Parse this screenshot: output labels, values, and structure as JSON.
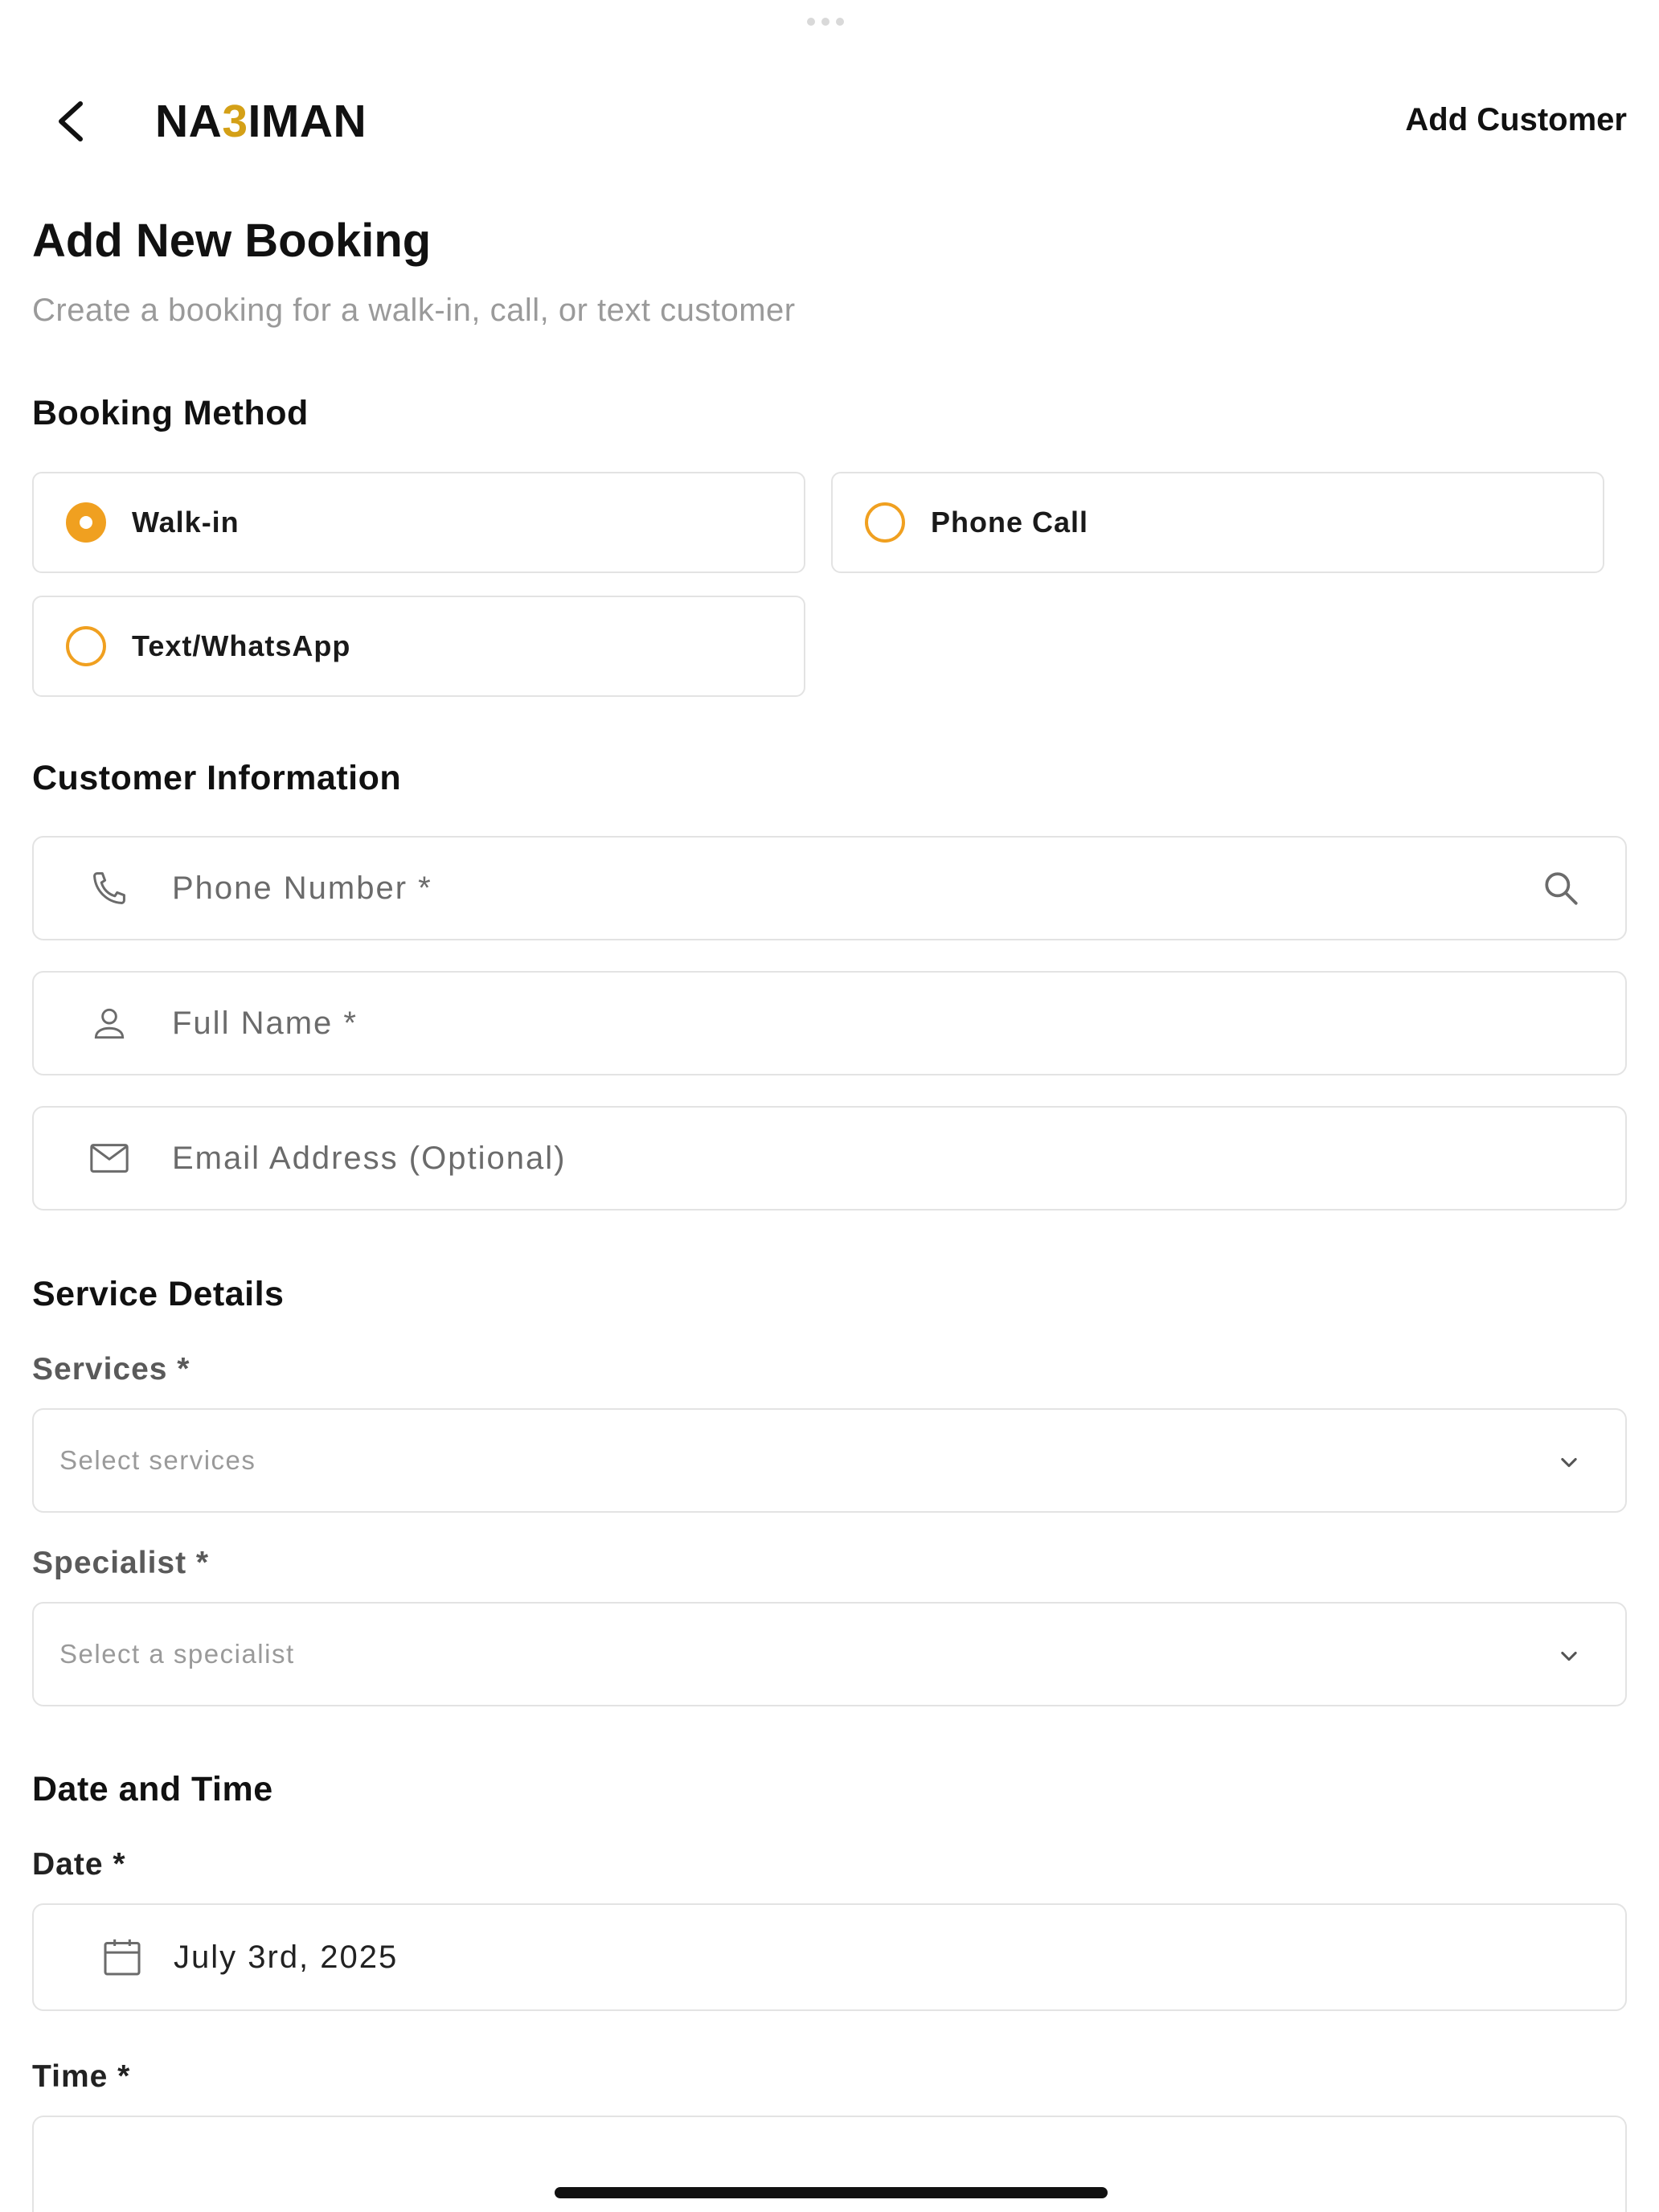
{
  "header": {
    "logo_prefix": "NA",
    "logo_accent": "3",
    "logo_suffix": "IMAN",
    "action_label": "Add Customer",
    "back_icon": "chevron-left-icon"
  },
  "page": {
    "title": "Add New Booking",
    "subtitle": "Create a booking for a walk-in, call, or text customer"
  },
  "booking_method": {
    "title": "Booking Method",
    "options": [
      {
        "label": "Walk-in",
        "selected": true
      },
      {
        "label": "Phone Call",
        "selected": false
      },
      {
        "label": "Text/WhatsApp",
        "selected": false
      }
    ]
  },
  "customer_info": {
    "title": "Customer Information",
    "phone_placeholder": "Phone Number *",
    "name_placeholder": "Full Name *",
    "email_placeholder": "Email Address (Optional)"
  },
  "service_details": {
    "title": "Service Details",
    "services_label": "Services *",
    "services_placeholder": "Select services",
    "specialist_label": "Specialist *",
    "specialist_placeholder": "Select a specialist"
  },
  "date_time": {
    "title": "Date and Time",
    "date_label": "Date *",
    "date_value": "July 3rd, 2025",
    "time_label": "Time *"
  },
  "colors": {
    "accent": "#f0a020",
    "logo_accent": "#d4a017",
    "border": "#e3e3e3",
    "muted_text": "#9a9a9a"
  }
}
